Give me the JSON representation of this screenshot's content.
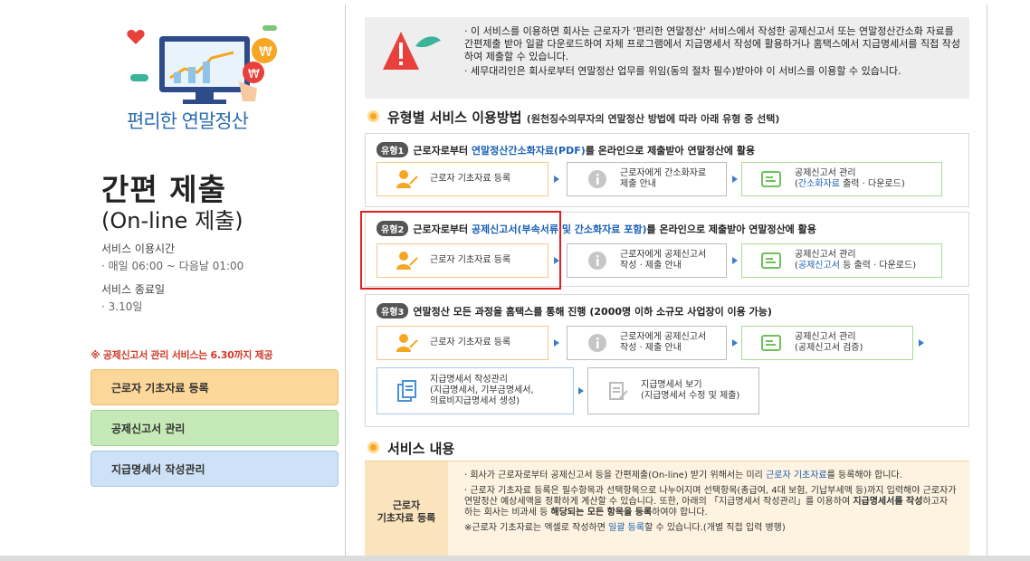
{
  "left": {
    "brand": "편리한 연말정산",
    "title": "간편 제출",
    "subtitle": "(On-line 제출)",
    "service_time_label": "서비스 이용시간",
    "service_time_value": "· 매일 06:00 ~ 다음날 01:00",
    "service_end_label": "서비스 종료일",
    "service_end_value": "· 3.10일",
    "notice": "※ 공제신고서 관리 서비스는 6.30까지 제공",
    "buttons": [
      "근로자 기초자료 등록",
      "공제신고서 관리",
      "지급명세서 작성관리"
    ]
  },
  "warning": {
    "line1": "· 이 서비스를 이용하면 회사는 근로자가 '편리한 연말정산' 서비스에서 작성한 공제신고서 또는 연말정산간소화 자료를 간편제출 받아 일괄 다운로드하여 자체 프로그램에서 지급명세서 작성에 활용하거나 홈택스에서 지급명세서를 직접 작성하여 제출할 수 있습니다.",
    "line2": "· 세무대리인은 회사로부터 연말정산 업무를 위임(동의 절차 필수)받아야 이 서비스를 이용할 수 있습니다."
  },
  "section1": {
    "title": "유형별 서비스 이용방법",
    "note": "(원천징수의무자의 연말정산 방법에 따라 아래 유형 중 선택)"
  },
  "type1": {
    "tag": "유형1",
    "pre": "근로자로부터 ",
    "link": "연말정산간소화자료(PDF)",
    "post": "를 온라인으로 제출받아 연말정산에 활용",
    "s1": "근로자 기초자료 등록",
    "s2a": "근로자에게 간소화자료",
    "s2b": "제출 안내",
    "s3a": "공제신고서 관리",
    "s3b_link": "간소화자료",
    "s3b_post": " 출력 · 다운로드)"
  },
  "type2": {
    "tag": "유형2",
    "pre": "근로자로부터 ",
    "link": "공제신고서(부속서류 및 간소화자료 포함)",
    "post": "를 온라인으로 제출받아 연말정산에 활용",
    "s1": "근로자 기초자료 등록",
    "s2a": "근로자에게 공제신고서",
    "s2b": "작성 · 제출 안내",
    "s3a": "공제신고서 관리",
    "s3b_link": "공제신고서",
    "s3b_post": " 등 출력 · 다운로드)"
  },
  "type3": {
    "tag": "유형3",
    "text": "연말정산 모든 과정을 홈택스를 통해 진행 (2000명 이하 소규모 사업장이 이용 가능)",
    "s1": "근로자 기초자료 등록",
    "s2a": "근로자에게 공제신고서",
    "s2b": "작성 · 제출 안내",
    "s3a": "공제신고서 관리",
    "s3b": "(공제신고서 검증)",
    "s4a": "지급명세서 작성관리",
    "s4b": "(지급명세서, 기부금명세서,",
    "s4c": "의료비지급명세서 생성)",
    "s5a": "지급명세서 보기",
    "s5b": "(지급명세서 수정 및 제출)"
  },
  "section2": {
    "title": "서비스 내용"
  },
  "service": {
    "label_a": "근로자",
    "label_b": "기초자료 등록",
    "p1_pre": "· 회사가 근로자로부터 공제신고서 등을 간편제출(On-line) 받기 위해서는 미리 ",
    "p1_link": "근로자 기초자료",
    "p1_post": "를 등록해야 합니다.",
    "p2_a": "· 근로자 기초자료 등록은 필수항목과 선택항목으로 나누어지며 선택항목(총급여, 4대 보험, 기납부세액 등)까지 입력해야 근로자가 연말정산 예상세액을 정확하게 계산할 수 있습니다. 또한, 아래의 「지급명세서 작성관리」를 이용하여 ",
    "p2_b": "지급명세서를 작성",
    "p2_c": "하고자 하는 회사는 비과세 등 ",
    "p2_d": "해당되는 모든 항목을 등록",
    "p2_e": "하여야 합니다.",
    "p3_pre": "※근로자 기초자료는 엑셀로 작성하면 ",
    "p3_link": "일괄 등록",
    "p3_post": "할 수 있습니다.(개별 직접 입력 병행)"
  }
}
